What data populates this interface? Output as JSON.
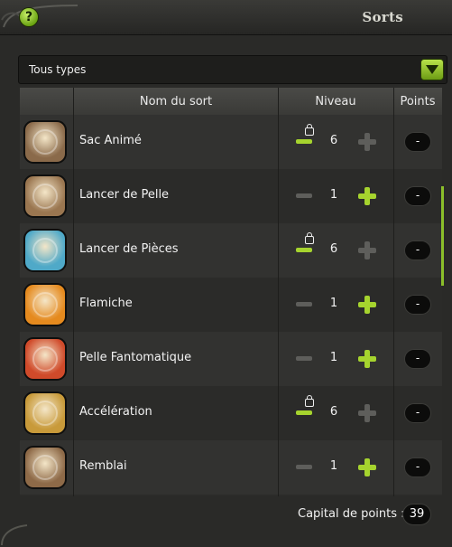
{
  "window": {
    "title": "Sorts",
    "help_label": "?"
  },
  "filter": {
    "selected": "Tous types"
  },
  "table": {
    "headers": {
      "name": "Nom du sort",
      "level": "Niveau",
      "points": "Points"
    },
    "rows": [
      {
        "name": "Sac Animé",
        "level": "6",
        "points": "-",
        "locked": true,
        "can_decrease": true,
        "can_increase": false,
        "icon": "animated-bag-icon",
        "icon_color": "#8a6a4a"
      },
      {
        "name": "Lancer de Pelle",
        "level": "1",
        "points": "-",
        "locked": false,
        "can_decrease": false,
        "can_increase": true,
        "icon": "shovel-throw-icon",
        "icon_color": "#9a7650"
      },
      {
        "name": "Lancer de Pièces",
        "level": "6",
        "points": "-",
        "locked": true,
        "can_decrease": true,
        "can_increase": false,
        "icon": "coin-throw-icon",
        "icon_color": "#4fa9c8"
      },
      {
        "name": "Flamiche",
        "level": "1",
        "points": "-",
        "locked": false,
        "can_decrease": false,
        "can_increase": true,
        "icon": "flame-spiral-icon",
        "icon_color": "#e58a1e"
      },
      {
        "name": "Pelle Fantomatique",
        "level": "1",
        "points": "-",
        "locked": false,
        "can_decrease": false,
        "can_increase": true,
        "icon": "ghost-shovel-icon",
        "icon_color": "#d04a2a"
      },
      {
        "name": "Accélération",
        "level": "6",
        "points": "-",
        "locked": true,
        "can_decrease": true,
        "can_increase": false,
        "icon": "acceleration-icon",
        "icon_color": "#c89a3a"
      },
      {
        "name": "Remblai",
        "level": "1",
        "points": "-",
        "locked": false,
        "can_decrease": false,
        "can_increase": true,
        "icon": "embankment-icon",
        "icon_color": "#8e6a48"
      }
    ]
  },
  "footer": {
    "capital_label": "Capital de points :",
    "capital_value": "39"
  },
  "colors": {
    "accent_green": "#a6d42e",
    "disabled_gray": "#5e5e5b",
    "background": "#2a2a28"
  }
}
